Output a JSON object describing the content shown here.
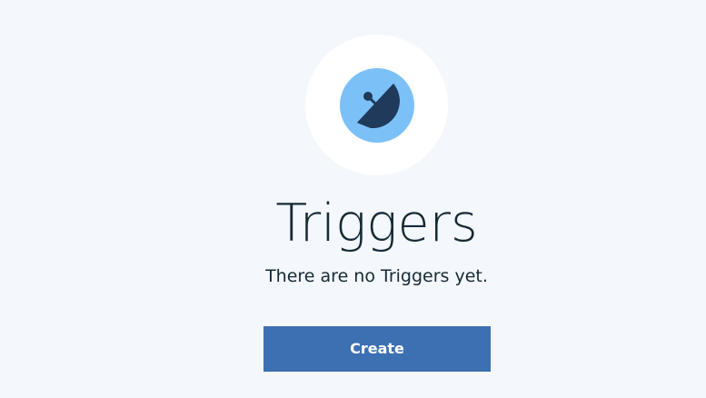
{
  "empty_state": {
    "icon": "satellite-dish-icon",
    "title": "Triggers",
    "message": "There are no Triggers yet.",
    "create_label": "Create"
  },
  "colors": {
    "background": "#f4f7fb",
    "icon_ring": "#ffffff",
    "icon_circle": "#7cc0f8",
    "icon_glyph": "#1f3a5a",
    "text": "#152935",
    "button": "#3d70b2",
    "button_text": "#ffffff"
  }
}
